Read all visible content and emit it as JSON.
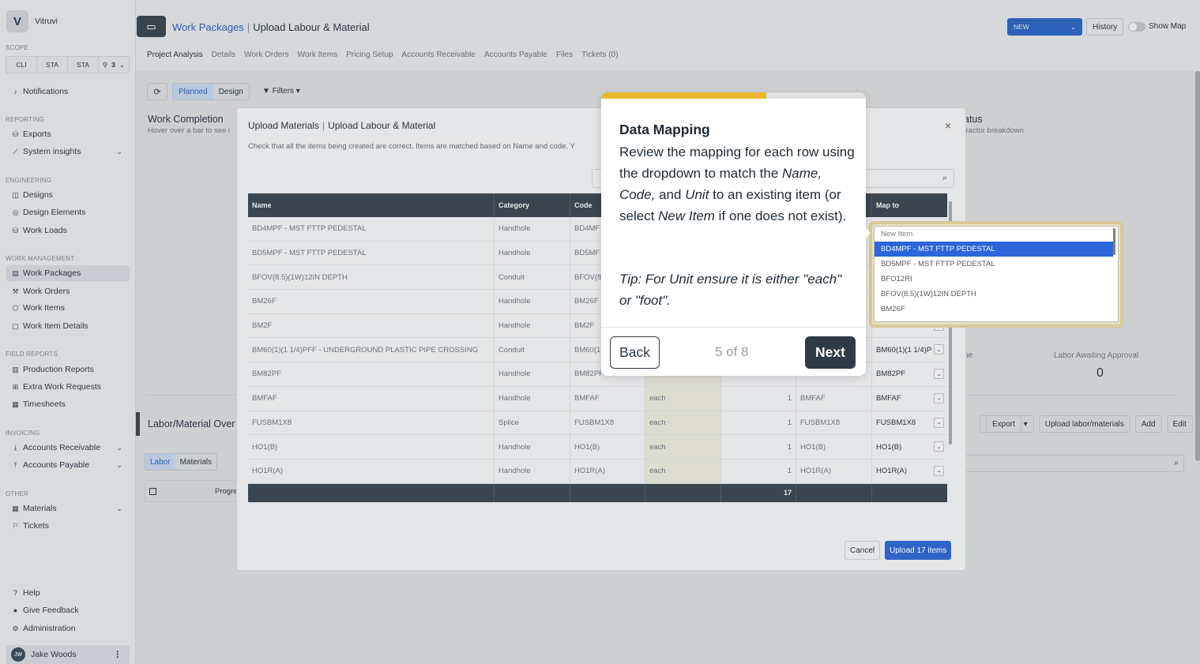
{
  "app": {
    "name": "Vitruvi",
    "logo_letter": "V"
  },
  "sidebar": {
    "scope_title": "SCOPE",
    "scope": [
      "CLI",
      "STA",
      "STA",
      "3"
    ],
    "notifications": "Notifications",
    "sections": {
      "reporting": "REPORTING",
      "engineering": "ENGINEERING",
      "work_management": "WORK MANAGEMENT",
      "field_reports": "FIELD REPORTS",
      "invoicing": "INVOICING",
      "other": "OTHER"
    },
    "items": {
      "exports": "Exports",
      "system_insights": "System insights",
      "designs": "Designs",
      "design_elements": "Design Elements",
      "work_loads": "Work Loads",
      "work_packages": "Work Packages",
      "work_orders": "Work Orders",
      "work_items": "Work Items",
      "work_item_details": "Work Item Details",
      "production_reports": "Production Reports",
      "extra_work_requests": "Extra Work Requests",
      "timesheets": "Timesheets",
      "accounts_receivable": "Accounts Receivable",
      "accounts_payable": "Accounts Payable",
      "materials": "Materials",
      "tickets": "Tickets",
      "help": "Help",
      "give_feedback": "Give Feedback",
      "administration": "Administration"
    },
    "user": {
      "initials": "JW",
      "name": "Jake Woods"
    }
  },
  "header": {
    "breadcrumb_link": "Work Packages",
    "breadcrumb_current": "Upload Labour & Material",
    "new_label": "NEW",
    "history_label": "History",
    "show_map_label": "Show Map",
    "tabs": [
      "Project Analysis",
      "Details",
      "Work Orders",
      "Work Items",
      "Pricing Setup",
      "Accounts Receivable",
      "Accounts Payable",
      "Files",
      "Tickets (0)"
    ]
  },
  "background": {
    "planned": "Planned",
    "design": "Design",
    "filters": "Filters",
    "work_completion_title": "Work Completion",
    "work_completion_sub": "Hover over a bar to see l",
    "status_title": "atus",
    "status_sub": "tractor breakdown",
    "ne_text": "ne",
    "labor_awaiting_label": "Labor Awaiting Approval",
    "labor_awaiting_value": "0",
    "lm_title": "Labor/Material Over",
    "export": "Export",
    "upload_lm": "Upload labor/materials",
    "add": "Add",
    "edit": "Edit",
    "labor": "Labor",
    "materials": "Materials",
    "progress_col": "Progre"
  },
  "modal": {
    "title_a": "Upload Materials",
    "title_b": "Upload Labour & Material",
    "description": "Check that all the items being created are correct. Items are matched based on Name and code. Y",
    "columns": [
      "Name",
      "Category",
      "Code",
      "",
      "",
      "",
      "Map to"
    ],
    "rows": [
      {
        "name": "BD4MPF - MST FTTP PEDESTAL",
        "category": "Handhole",
        "code": "BD4MF",
        "unit": "",
        "qty": "",
        "map_code": "",
        "map_to": ""
      },
      {
        "name": "BD5MPF - MST FTTP PEDESTAL",
        "category": "Handhole",
        "code": "BD5MF",
        "unit": "",
        "qty": "",
        "map_code": "",
        "map_to": ""
      },
      {
        "name": "BFOV(8.5)(1W)12IN DEPTH",
        "category": "Conduit",
        "code": "BFOV(8",
        "unit": "",
        "qty": "",
        "map_code": "",
        "map_to": ""
      },
      {
        "name": "BM26F",
        "category": "Handhole",
        "code": "BM26F",
        "unit": "",
        "qty": "",
        "map_code": "",
        "map_to": ""
      },
      {
        "name": "BM2F",
        "category": "Handhole",
        "code": "BM2F",
        "unit": "",
        "qty": "",
        "map_code": "",
        "map_to": "BM2F"
      },
      {
        "name": "BM60(1)(1 1/4)PFF - UNDERGROUND PLASTIC PIPE CROSSING",
        "category": "Conduit",
        "code": "BM60(1",
        "unit": "",
        "qty": "",
        "map_code": "",
        "map_to": "BM60(1)(1 1/4)P"
      },
      {
        "name": "BM82PF",
        "category": "Handhole",
        "code": "BM82PF",
        "unit": "",
        "qty": "",
        "map_code": "",
        "map_to": "BM82PF"
      },
      {
        "name": "BMFAF",
        "category": "Handhole",
        "code": "BMFAF",
        "unit": "each",
        "qty": "1",
        "map_code": "BMFAF",
        "map_to": "BMFAF"
      },
      {
        "name": "FUSBM1X8",
        "category": "Splice",
        "code": "FUSBM1X8",
        "unit": "each",
        "qty": "1",
        "map_code": "FUSBM1X8",
        "map_to": "FUSBM1X8"
      },
      {
        "name": "HO1(B)",
        "category": "Handhole",
        "code": "HO1(B)",
        "unit": "each",
        "qty": "1",
        "map_code": "HO1(B)",
        "map_to": "HO1(B)"
      },
      {
        "name": "HO1R(A)",
        "category": "Handhole",
        "code": "HO1R(A)",
        "unit": "each",
        "qty": "1",
        "map_code": "HO1R(A)",
        "map_to": "HO1R(A)"
      }
    ],
    "footer_total": "17",
    "cancel": "Cancel",
    "upload": "Upload 17 items"
  },
  "dropdown": {
    "options": [
      "New Item",
      "BD4MPF - MST FTTP PEDESTAL",
      "BD5MPF - MST FTTP PEDESTAL",
      "BFO12RI",
      "BFOV(8.5)(1W)12IN DEPTH",
      "BM26F"
    ],
    "selected_index": 1
  },
  "tour": {
    "progress": 0.625,
    "title": "Data Mapping",
    "body_1": "Review the mapping for each row using the dropdown to match the ",
    "body_name": "Name, Code,",
    "body_2": " and ",
    "body_unit": "Unit",
    "body_3": " to an existing item (or select ",
    "body_new": "New Item",
    "body_4": " if one does not exist).",
    "tip": "Tip: For Unit ensure it is either \"each\" or \"foot\".",
    "back": "Back",
    "counter": "5 of 8",
    "next": "Next"
  },
  "colors": {
    "accent": "#2e61b8",
    "tour_progress": "#e8b82c",
    "dark": "#3a4550"
  }
}
